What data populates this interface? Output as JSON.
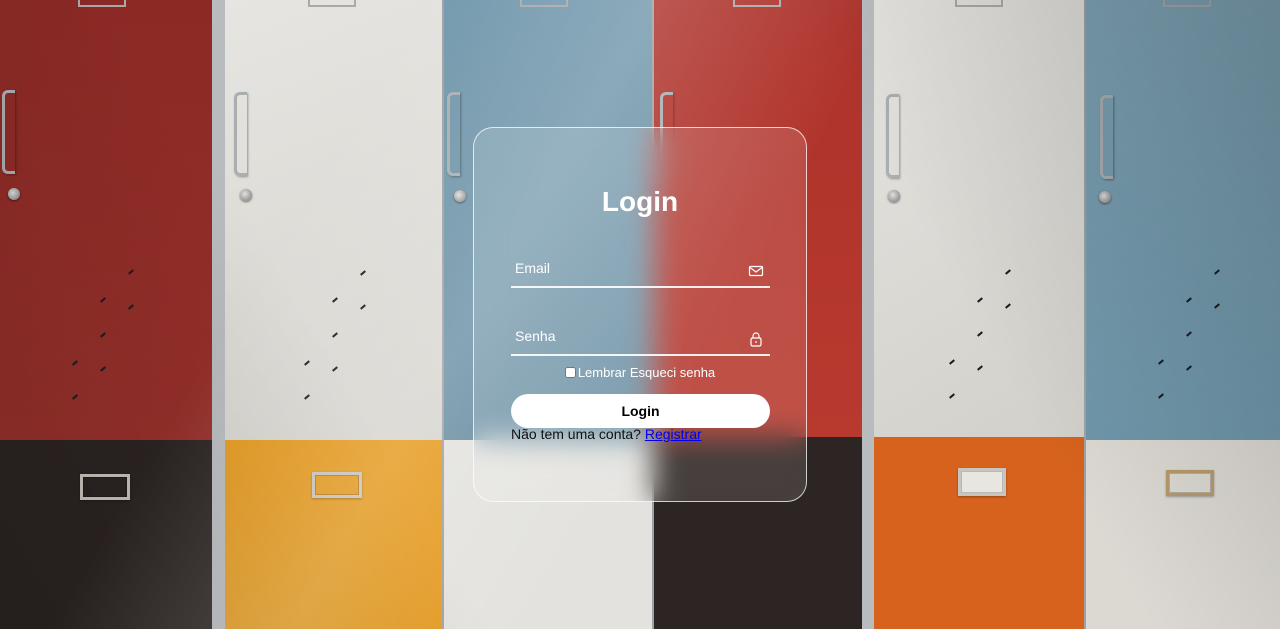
{
  "background": {
    "description": "Wall of colorful school lockers"
  },
  "login": {
    "title": "Login",
    "email": {
      "placeholder": "Email",
      "icon": "mail-icon"
    },
    "password": {
      "placeholder": "Senha",
      "icon": "lock-icon"
    },
    "remember_label": "Lembrar",
    "forgot_label": "Esqueci senha",
    "submit_label": "Login",
    "no_account_text": "Não tem uma conta?",
    "register_label": "Registrar"
  },
  "colors": {
    "red_locker": "#8e2a26",
    "white_locker": "#e4e3df",
    "blue_locker": "#6f97aa",
    "orange_locker": "#d7661f",
    "yellow_locker": "#e89b1d",
    "dark_locker": "#2a2321"
  }
}
